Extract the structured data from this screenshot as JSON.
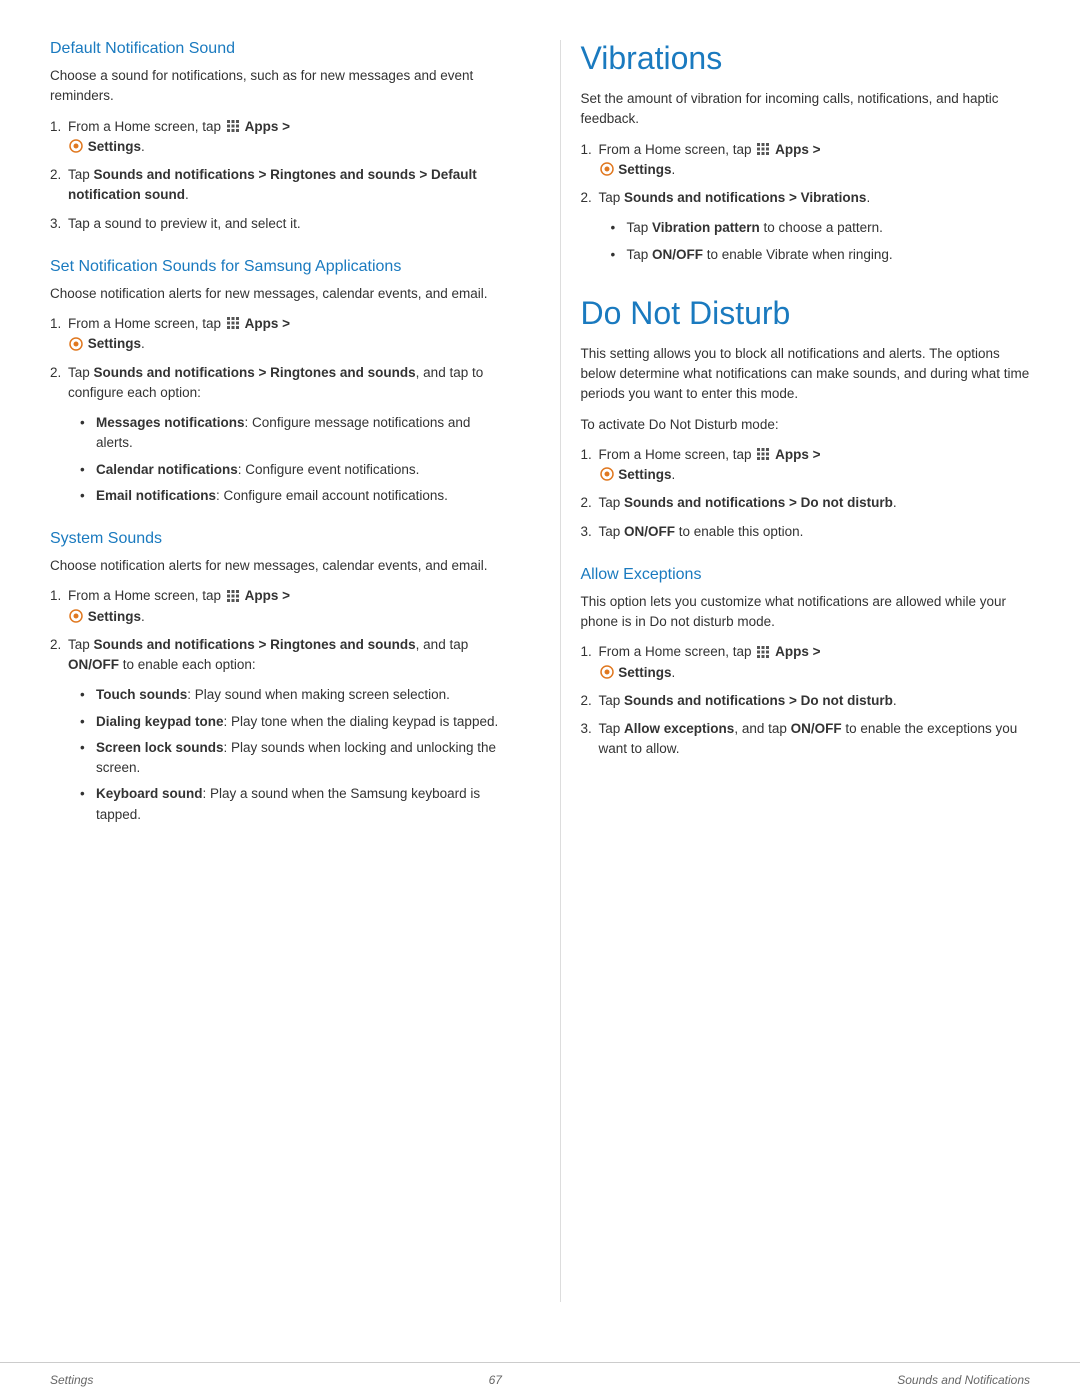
{
  "footer": {
    "left": "Settings",
    "center": "67",
    "right": "Sounds and Notifications"
  },
  "left": {
    "section1": {
      "title": "Default Notification Sound",
      "intro": "Choose a sound for notifications, such as for new messages and event reminders.",
      "steps": [
        {
          "num": "1.",
          "text_before": "From a Home screen, tap",
          "apps_icon": true,
          "bold_apps": "Apps >",
          "settings_icon": true,
          "bold_settings": "Settings",
          "period": "."
        },
        {
          "num": "2.",
          "text": "Tap Sounds and notifications > Ringtones and sounds > Default notification sound."
        },
        {
          "num": "3.",
          "text": "Tap a sound to preview it, and select it."
        }
      ]
    },
    "section2": {
      "title": "Set Notification Sounds for Samsung Applications",
      "intro": "Choose notification alerts for new messages, calendar events, and email.",
      "steps": [
        {
          "num": "1.",
          "text_before": "From a Home screen, tap",
          "apps_icon": true,
          "bold_apps": "Apps >",
          "settings_icon": true,
          "bold_settings": "Settings",
          "period": "."
        },
        {
          "num": "2.",
          "text_before": "Tap",
          "bold1": "Sounds and notifications > Ringtones and sounds",
          "text_after": ", and tap to configure each option:"
        }
      ],
      "bullets": [
        {
          "bold": "Messages notifications",
          "text": ": Configure message notifications and alerts."
        },
        {
          "bold": "Calendar notifications",
          "text": ": Configure event notifications."
        },
        {
          "bold": "Email notifications",
          "text": ": Configure email account notifications."
        }
      ]
    },
    "section3": {
      "title": "System Sounds",
      "intro": "Choose notification alerts for new messages, calendar events, and email.",
      "steps": [
        {
          "num": "1.",
          "text_before": "From a Home screen, tap",
          "apps_icon": true,
          "bold_apps": "Apps >",
          "settings_icon": true,
          "bold_settings": "Settings",
          "period": "."
        },
        {
          "num": "2.",
          "text_before": "Tap",
          "bold1": "Sounds and notifications > Ringtones and sounds",
          "text_after": ", and tap",
          "bold2": "ON/OFF",
          "text_after2": "to enable each option:"
        }
      ],
      "bullets": [
        {
          "bold": "Touch sounds",
          "text": ": Play sound when making screen selection."
        },
        {
          "bold": "Dialing keypad tone",
          "text": ": Play tone when the dialing keypad is tapped."
        },
        {
          "bold": "Screen lock sounds",
          "text": ": Play sounds when locking and unlocking the screen."
        },
        {
          "bold": "Keyboard sound",
          "text": ": Play a sound when the Samsung keyboard is tapped."
        }
      ]
    }
  },
  "right": {
    "section1": {
      "title": "Vibrations",
      "intro": "Set the amount of vibration for incoming calls, notifications, and haptic feedback.",
      "steps": [
        {
          "num": "1.",
          "text_before": "From a Home screen, tap",
          "apps_icon": true,
          "bold_apps": "Apps >",
          "settings_icon": true,
          "bold_settings": "Settings",
          "period": "."
        },
        {
          "num": "2.",
          "text": "Tap Sounds and notifications > Vibrations."
        }
      ],
      "bullets": [
        {
          "bold": "Vibration pattern",
          "text": " to choose a pattern."
        },
        {
          "bold": "ON/OFF",
          "text": " to enable Vibrate when ringing."
        }
      ],
      "bullet_prefix": "Tap"
    },
    "section2": {
      "title": "Do Not Disturb",
      "intro": "This setting allows you to block all notifications and alerts. The options below determine what notifications can make sounds, and during what time periods you want to enter this mode.",
      "activate_text": "To activate Do Not Disturb mode:",
      "steps": [
        {
          "num": "1.",
          "text_before": "From a Home screen, tap",
          "apps_icon": true,
          "bold_apps": "Apps >",
          "settings_icon": true,
          "bold_settings": "Settings",
          "period": "."
        },
        {
          "num": "2.",
          "text": "Tap Sounds and notifications > Do not disturb."
        },
        {
          "num": "3.",
          "text_before": "Tap",
          "bold1": "ON/OFF",
          "text_after": "to enable this option."
        }
      ]
    },
    "section3": {
      "title": "Allow Exceptions",
      "intro": "This option lets you customize what notifications are allowed while your phone is in Do not disturb mode.",
      "steps": [
        {
          "num": "1.",
          "text_before": "From a Home screen, tap",
          "apps_icon": true,
          "bold_apps": "Apps >",
          "settings_icon": true,
          "bold_settings": "Settings",
          "period": "."
        },
        {
          "num": "2.",
          "text": "Tap Sounds and notifications > Do not disturb."
        },
        {
          "num": "3.",
          "text_before": "Tap",
          "bold1": "Allow exceptions",
          "text_middle": ", and tap",
          "bold2": "ON/OFF",
          "text_after": "to enable the exceptions you want to allow."
        }
      ]
    }
  }
}
